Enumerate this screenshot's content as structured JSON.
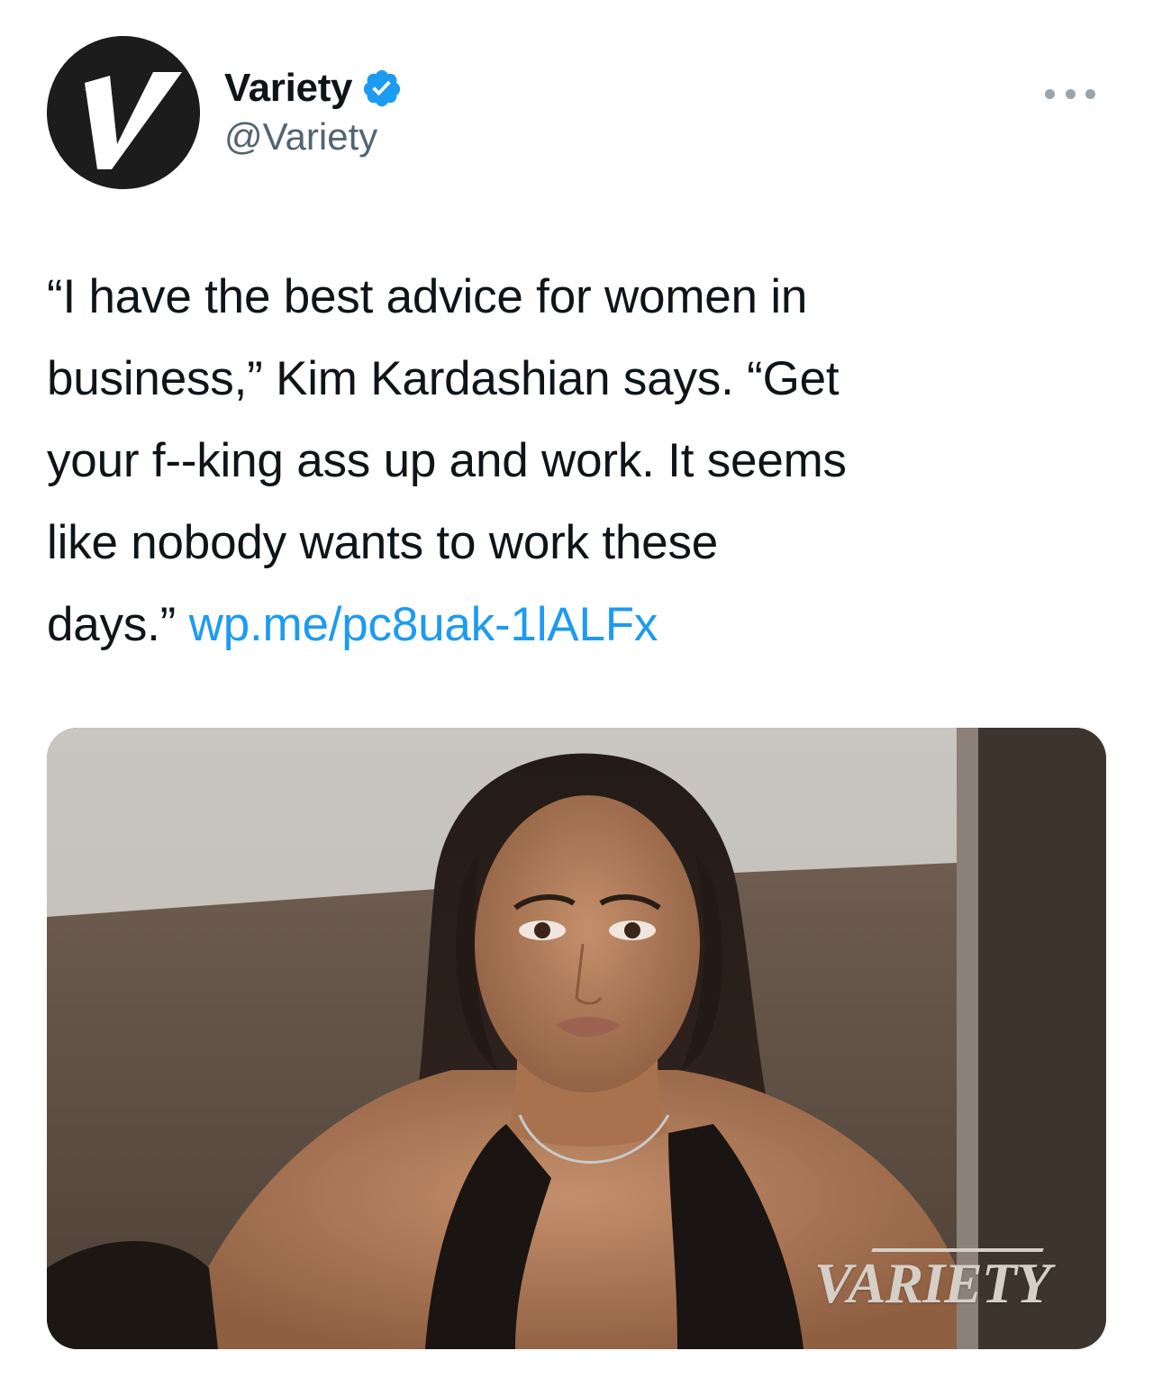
{
  "account": {
    "display_name": "Variety",
    "handle": "@Variety",
    "avatar_icon": "variety-v-logo",
    "verified_icon": "verified-badge-icon",
    "verified_color": "#1d9bf0"
  },
  "menu": {
    "more_icon": "more-options-icon"
  },
  "tweet": {
    "lines": [
      "“I have the best advice for women in",
      "business,” Kim Kardashian says. “Get",
      "your f--king ass up and work. It seems",
      "like nobody wants to work these"
    ],
    "last_line_text": "days.” ",
    "link": "wp.me/pc8uak-1lALFx",
    "link_color": "#1d9bf0"
  },
  "media": {
    "watermark": "VARIETY"
  }
}
